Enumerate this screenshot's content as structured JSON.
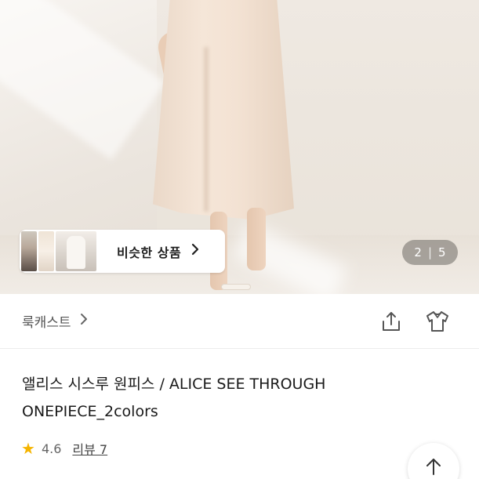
{
  "hero": {
    "similar_products_label": "비슷한 상품",
    "chevron_icon": "chevron-right-icon",
    "counter": {
      "current": "2",
      "separator": "|",
      "total": "5"
    }
  },
  "brand": {
    "name": "룩캐스트",
    "chevron_icon": "chevron-right-icon",
    "share_icon": "share-icon",
    "fitting_icon": "tshirt-icon"
  },
  "product": {
    "title": "앨리스 시스루 원피스 / ALICE SEE THROUGH ONEPIECE_2colors"
  },
  "rating": {
    "star_icon": "star-icon",
    "value": "4.6",
    "review_label": "리뷰 7"
  },
  "scroll_top_icon": "arrow-up-icon",
  "colors": {
    "star": "#f5b400",
    "text": "#1a1a1a",
    "muted": "#666666"
  }
}
